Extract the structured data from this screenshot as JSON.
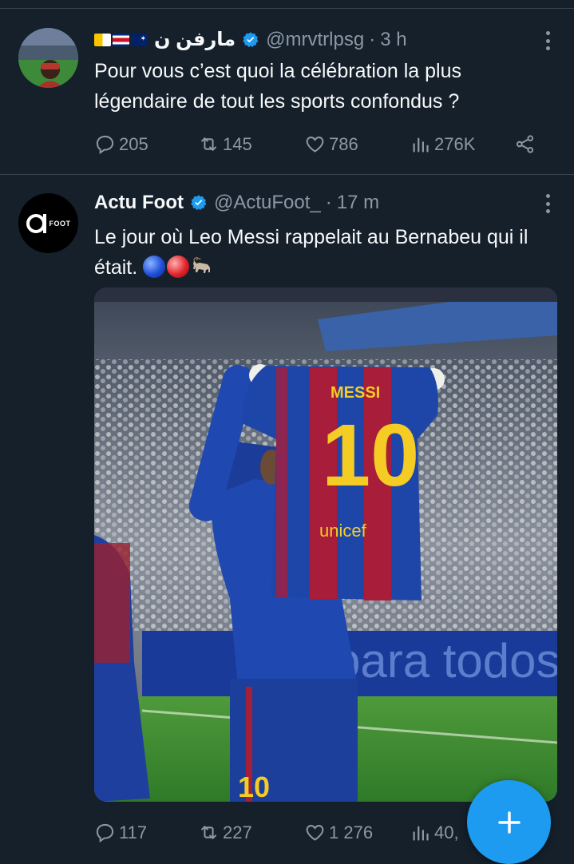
{
  "tweets": [
    {
      "display_name": "مارفن ن",
      "flags": [
        "vatican-flag",
        "costa-rica-flag",
        "australia-flag"
      ],
      "verified": true,
      "handle": "@mrvtrlpsg",
      "separator": "·",
      "time": "3 h",
      "text": "Pour vous c’est quoi la célébration la plus légendaire de tout les sports confondus ?",
      "stats": {
        "replies": "205",
        "retweets": "145",
        "likes": "786",
        "views": "276K"
      }
    },
    {
      "display_name": "Actu Foot",
      "avatar_text": "FOOT",
      "verified": true,
      "handle": "@ActuFoot_",
      "separator": "·",
      "time": "17 m",
      "text": "Le jour où Leo Messi rappelait au Bernabeu qui il était.",
      "emojis": [
        "blue-circle",
        "red-circle",
        "goat"
      ],
      "media": {
        "shirt_name": "MESSI",
        "shirt_number": "10",
        "sponsor": "unicef",
        "board_text": "para todos",
        "shorts_number": "10"
      },
      "stats": {
        "replies": "117",
        "retweets": "227",
        "likes": "1 276",
        "views": "40,"
      }
    }
  ],
  "colors": {
    "background": "#15202b",
    "accent": "#1d9bf0",
    "muted": "#8b98a5",
    "text": "#f7f9f9",
    "divider": "#38444d"
  },
  "fab": {
    "icon": "plus-icon"
  }
}
